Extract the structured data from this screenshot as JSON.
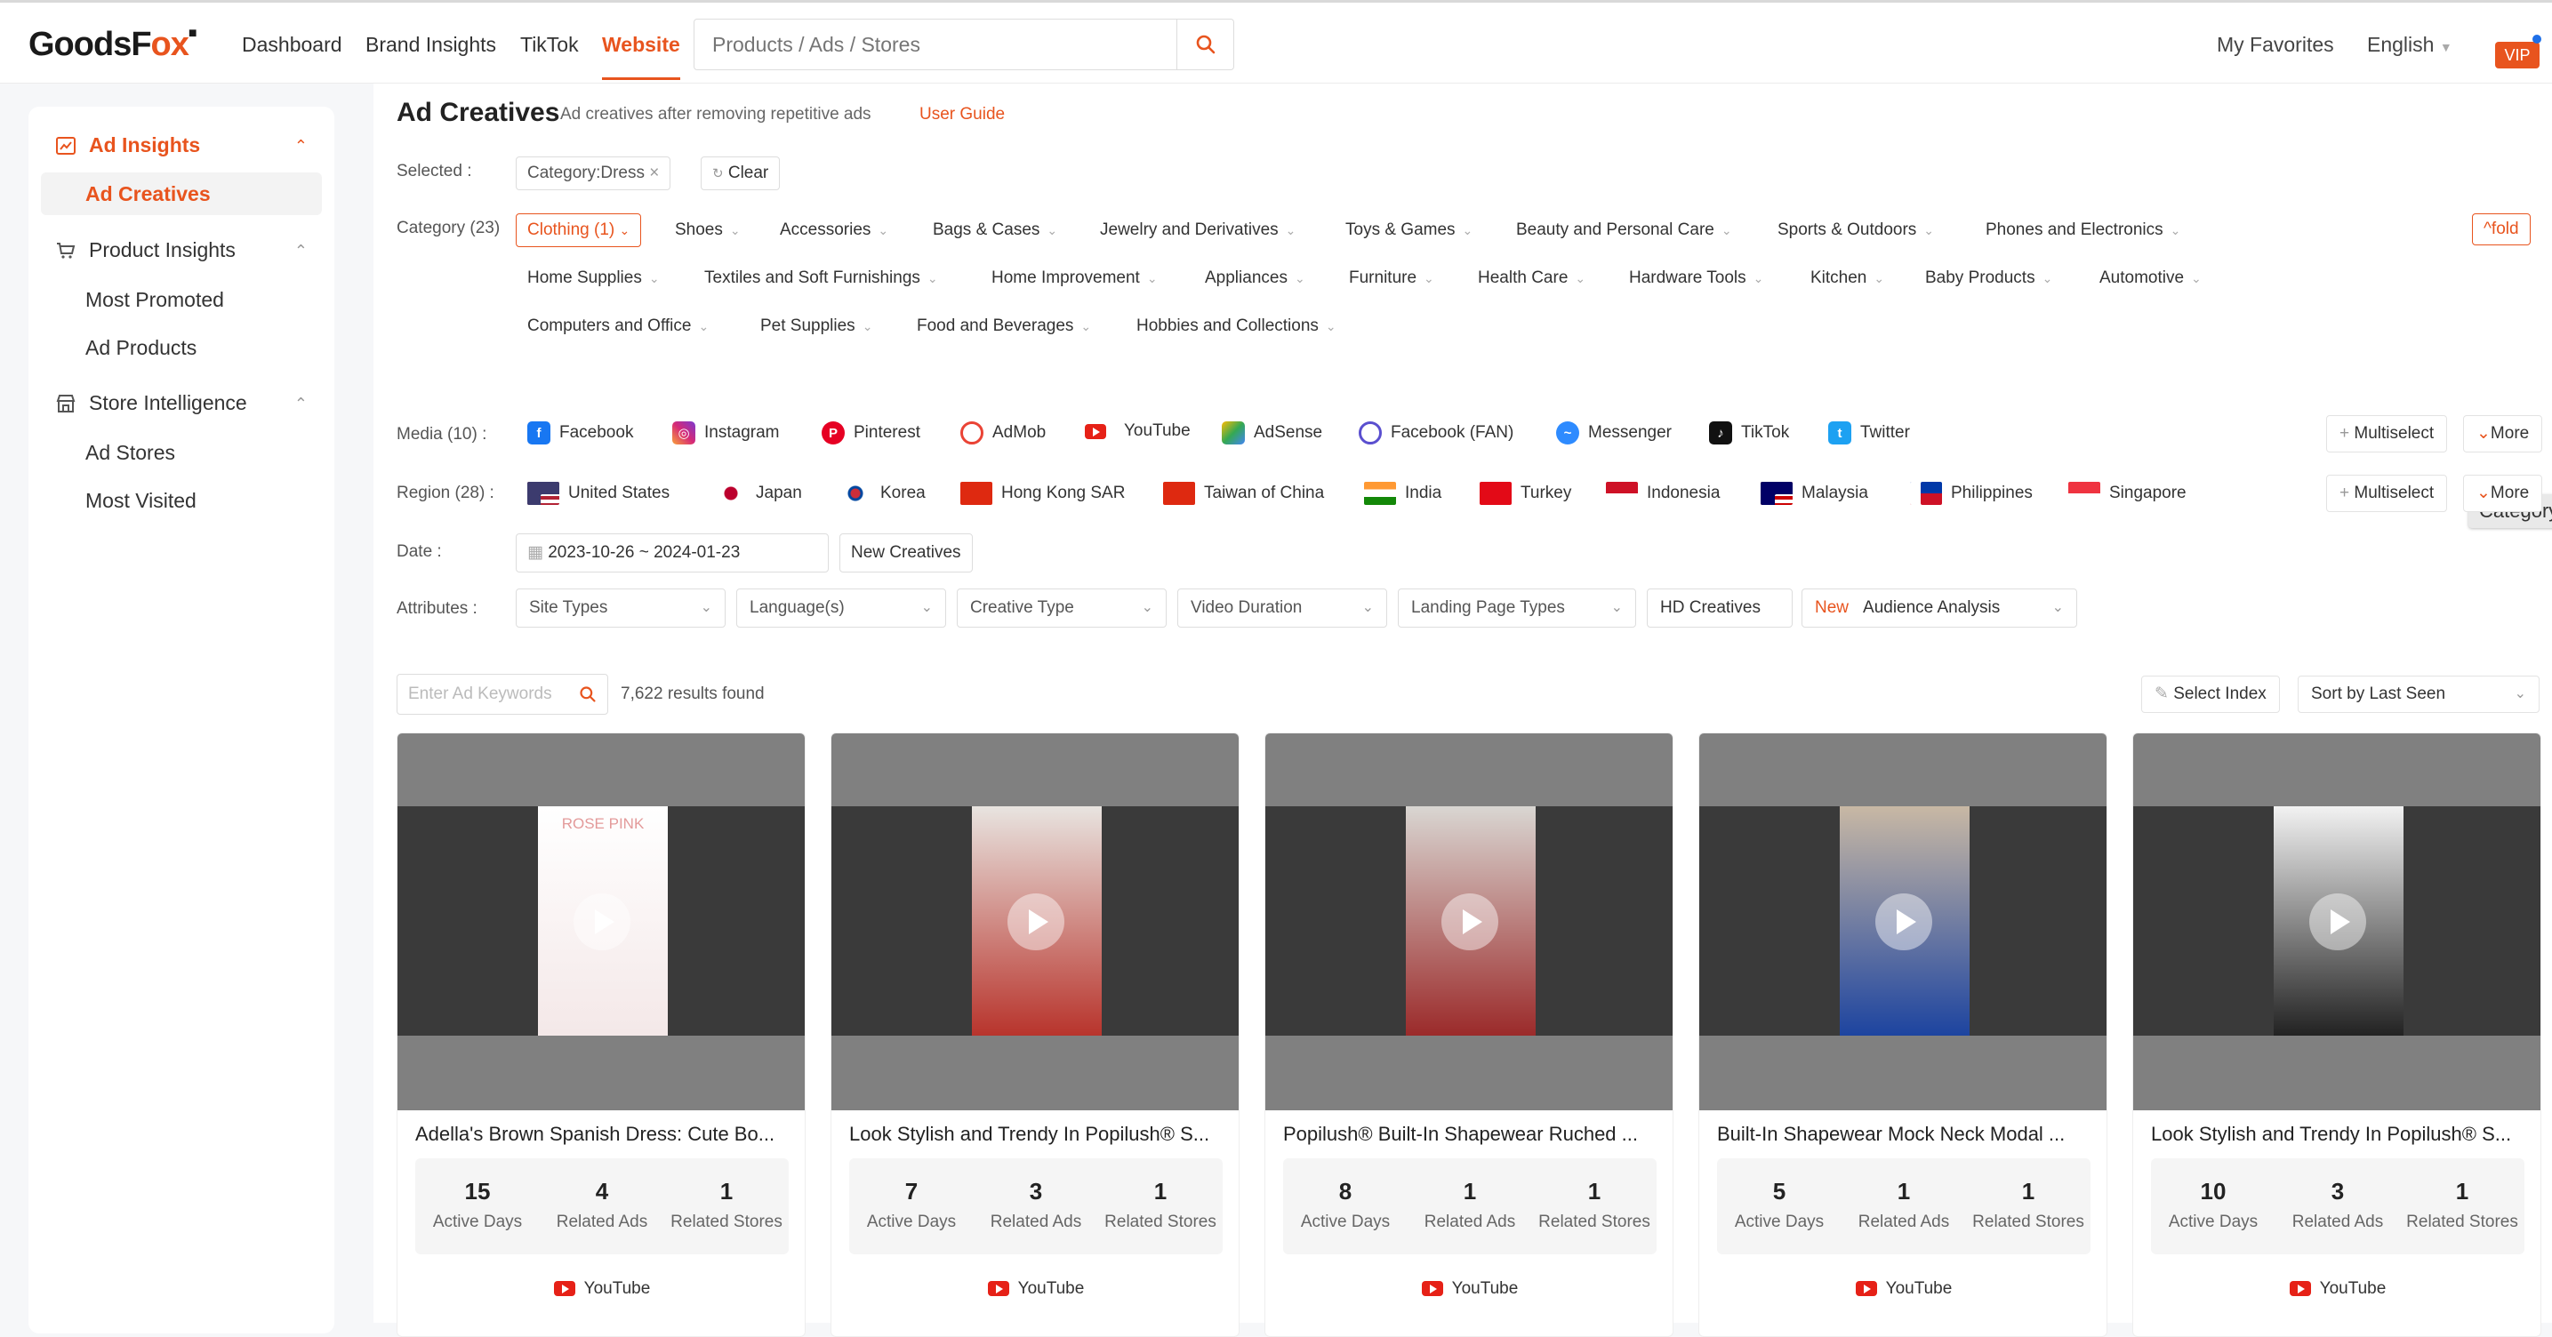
{
  "header": {
    "logo": {
      "a": "GoodsF",
      "b": "ox"
    },
    "nav": [
      "Dashboard",
      "Brand Insights",
      "TikTok",
      "Website"
    ],
    "search_placeholder": "Products / Ads / Stores",
    "favorites": "My Favorites",
    "language": "English",
    "vip": "VIP"
  },
  "sidebar": {
    "groups": [
      {
        "label": "Ad Insights",
        "items": [
          "Ad Creatives"
        ]
      },
      {
        "label": "Product Insights",
        "items": [
          "Most Promoted",
          "Ad Products"
        ]
      },
      {
        "label": "Store Intelligence",
        "items": [
          "Ad Stores",
          "Most Visited"
        ]
      }
    ]
  },
  "page": {
    "title": "Ad Creatives",
    "subtitle": "Ad creatives after removing repetitive ads",
    "guide": "User Guide"
  },
  "selected": {
    "label": "Selected :",
    "chip": "Category:Dress",
    "clear": "Clear"
  },
  "category": {
    "label": "Category (23)",
    "active": "Clothing (1)",
    "fold": "fold",
    "row1": [
      "Shoes",
      "Accessories",
      "Bags & Cases",
      "Jewelry and Derivatives",
      "Toys & Games",
      "Beauty and Personal Care",
      "Sports & Outdoors",
      "Phones and Electronics"
    ],
    "row2": [
      "Home Supplies",
      "Textiles and Soft Furnishings",
      "Home Improvement",
      "Appliances",
      "Furniture",
      "Health Care",
      "Hardware Tools",
      "Kitchen",
      "Baby Products",
      "Automotive"
    ],
    "row3": [
      "Computers and Office",
      "Pet Supplies",
      "Food and Beverages",
      "Hobbies and Collections"
    ]
  },
  "tooltip": "Category",
  "media": {
    "label": "Media (10) :",
    "items": [
      "Facebook",
      "Instagram",
      "Pinterest",
      "AdMob",
      "YouTube",
      "AdSense",
      "Facebook (FAN)",
      "Messenger",
      "TikTok",
      "Twitter"
    ],
    "multiselect": "Multiselect",
    "more": "More"
  },
  "region": {
    "label": "Region (28) :",
    "items": [
      "United States",
      "Japan",
      "Korea",
      "Hong Kong SAR",
      "Taiwan of China",
      "India",
      "Turkey",
      "Indonesia",
      "Malaysia",
      "Philippines",
      "Singapore"
    ],
    "multiselect": "Multiselect",
    "more": "More"
  },
  "date": {
    "label": "Date :",
    "range": "2023-10-26 ~ 2024-01-23",
    "new_creatives": "New Creatives"
  },
  "attributes": {
    "label": "Attributes :",
    "selects": [
      "Site Types",
      "Language(s)",
      "Creative Type",
      "Video Duration",
      "Landing Page Types"
    ],
    "hd": "HD Creatives",
    "new_tag": "New",
    "audience": "Audience Analysis"
  },
  "results": {
    "keyword_placeholder": "Enter Ad Keywords",
    "count": "7,622 results found",
    "select_index": "Select Index",
    "sort": "Sort by Last Seen"
  },
  "cards": [
    {
      "title": "Adella's Brown Spanish Dress: Cute Bo...",
      "active_days": "15",
      "related_ads": "4",
      "related_stores": "1",
      "platform": "YouTube",
      "overlay": "ROSE PINK"
    },
    {
      "title": "Look Stylish and Trendy In Popilush® S...",
      "active_days": "7",
      "related_ads": "3",
      "related_stores": "1",
      "platform": "YouTube"
    },
    {
      "title": "Popilush® Built-In Shapewear Ruched ...",
      "active_days": "8",
      "related_ads": "1",
      "related_stores": "1",
      "platform": "YouTube"
    },
    {
      "title": "Built-In Shapewear Mock Neck Modal ...",
      "active_days": "5",
      "related_ads": "1",
      "related_stores": "1",
      "platform": "YouTube"
    },
    {
      "title": "Look Stylish and Trendy In Popilush® S...",
      "active_days": "10",
      "related_ads": "3",
      "related_stores": "1",
      "platform": "YouTube"
    }
  ],
  "stat_labels": {
    "active_days": "Active Days",
    "related_ads": "Related Ads",
    "related_stores": "Related Stores"
  }
}
